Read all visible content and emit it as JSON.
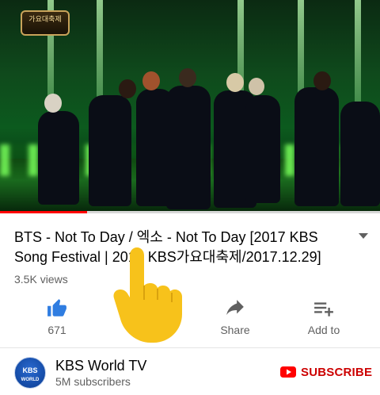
{
  "video": {
    "channel_badge_text": "가요대축제",
    "progress_fraction": 0.23
  },
  "title": "BTS - Not To Day / 엑소 - Not To Day  [2017 KBS Song Festival | 2017 KBS가요대축제/2017.12.29]",
  "views": "3.5K views",
  "actions": {
    "like_count": "671",
    "share_label": "Share",
    "add_label": "Add to"
  },
  "channel": {
    "name": "KBS World TV",
    "subscribers": "5M subscribers",
    "avatar_text_line1": "KBS",
    "avatar_text_line2": "WORLD"
  },
  "subscribe_label": "SUBSCRIBE",
  "colors": {
    "accent_red": "#cc0000",
    "like_blue": "#2f7de1",
    "progress_red": "#ff0000",
    "hand_yellow": "#f7c21b"
  },
  "icons": [
    "expand-chevron-icon",
    "thumbs-up-icon",
    "share-arrow-icon",
    "add-to-playlist-icon",
    "youtube-play-icon",
    "pointing-hand-icon"
  ]
}
